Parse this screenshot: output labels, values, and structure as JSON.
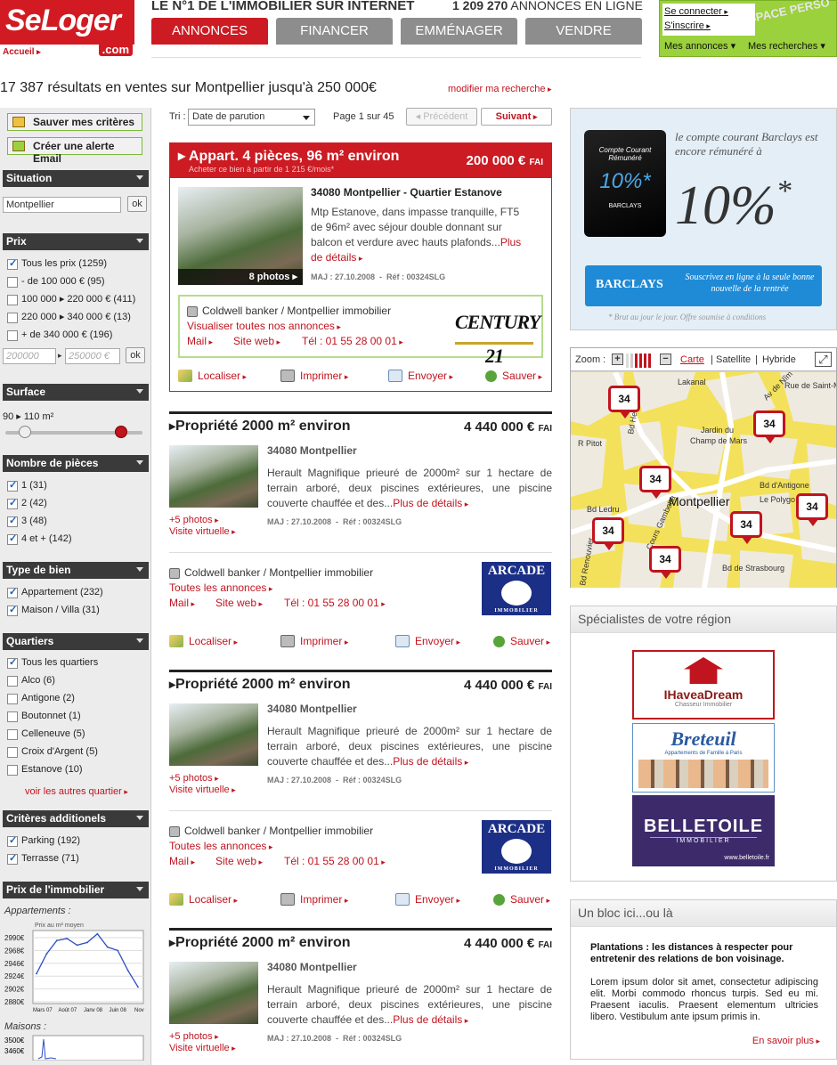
{
  "header": {
    "logo_text": "SeLoger",
    "logo_com": ".com",
    "accueil": "Accueil",
    "tagline": "LE N°1 DE L'IMMOBILIER SUR INTERNET",
    "ad_count": "1 209 270",
    "ad_count_label": "ANNONCES EN LIGNE",
    "tabs": [
      "ANNONCES",
      "FINANCER",
      "EMMÉNAGER",
      "VENDRE"
    ],
    "user": {
      "connect": "Se connecter",
      "signup": "S'inscrire",
      "my_ads": "Mes annonces",
      "my_searches": "Mes recherches",
      "watermark": "ESPACE PERSO"
    }
  },
  "results": {
    "title": "17 387 résultats en ventes sur Montpellier jusqu'à 250 000€",
    "modify": "modifier ma recherche"
  },
  "left": {
    "save_criteria": "Sauver mes critères",
    "create_alert": "Créer une alerte Email",
    "situation": {
      "title": "Situation",
      "value": "Montpellier",
      "ok": "ok"
    },
    "prix": {
      "title": "Prix",
      "options": [
        {
          "label": "Tous les prix (1259)",
          "checked": true
        },
        {
          "label": "- de 100 000 € (95)",
          "checked": false
        },
        {
          "label": "100 000 ▸ 220 000 € (411)",
          "checked": false
        },
        {
          "label": "220 000 ▸ 340 000 € (13)",
          "checked": false
        },
        {
          "label": "+ de 340 000 € (196)",
          "checked": false
        }
      ],
      "min_ph": "200000",
      "max_ph": "250000 €",
      "ok": "ok"
    },
    "surface": {
      "title": "Surface",
      "range": "90 ▸ 110 m²",
      "min_value": 90,
      "max_value": 110
    },
    "pieces": {
      "title": "Nombre de pièces",
      "options": [
        {
          "label": "1 (31)",
          "checked": true
        },
        {
          "label": "2 (42)",
          "checked": true
        },
        {
          "label": "3 (48)",
          "checked": true
        },
        {
          "label": "4 et + (142)",
          "checked": true
        }
      ]
    },
    "type": {
      "title": "Type de bien",
      "options": [
        {
          "label": "Appartement (232)",
          "checked": true
        },
        {
          "label": "Maison / Villa (31)",
          "checked": true
        }
      ]
    },
    "quartiers": {
      "title": "Quartiers",
      "options": [
        {
          "label": "Tous les quartiers",
          "checked": true
        },
        {
          "label": "Alco (6)",
          "checked": false
        },
        {
          "label": "Antigone (2)",
          "checked": false
        },
        {
          "label": "Boutonnet (1)",
          "checked": false
        },
        {
          "label": "Celleneuve (5)",
          "checked": false
        },
        {
          "label": "Croix d'Argent (5)",
          "checked": false
        },
        {
          "label": "Estanove (10)",
          "checked": false
        }
      ],
      "more": "voir les autres quartier"
    },
    "additionnels": {
      "title": "Critères additionels",
      "options": [
        {
          "label": "Parking (192)",
          "checked": true
        },
        {
          "label": "Terrasse (71)",
          "checked": true
        }
      ]
    },
    "prix_immo": {
      "title": "Prix de l'immobilier",
      "apparts": "Appartements :",
      "maisons": "Maisons :",
      "chart_title": "Prix au m² moyen",
      "yticks": [
        "2990€",
        "2968€",
        "2946€",
        "2924€",
        "2902€",
        "2880€"
      ],
      "xticks": [
        "Mars 07",
        "Août 07",
        "Janv 08",
        "Juin 08",
        "Nov"
      ],
      "maison_yticks": [
        "3500€",
        "3460€"
      ]
    }
  },
  "chart_data": {
    "type": "line",
    "title": "Prix au m² moyen",
    "x": [
      "Mars 07",
      "Août 07",
      "Janv 08",
      "Juin 08",
      "Nov"
    ],
    "series": [
      {
        "values": [
          2925,
          2955,
          2975,
          2978,
          2968,
          2972,
          2985,
          2965,
          2960,
          2930,
          2905
        ]
      }
    ],
    "ylim": [
      2880,
      2990
    ]
  },
  "toolbar": {
    "tri_label": "Tri :",
    "tri_value": "Date de parution",
    "page": "Page 1 sur 45",
    "prev": "◂ Précédent",
    "next": "Suivant"
  },
  "featured": {
    "title": "Appart. 4 pièces, 96 m² environ",
    "subtitle": "Acheter ce bien à partir de 1 215 €/mois*",
    "price": "200 000 €",
    "price_unit": "FAI",
    "location": "34080 Montpellier - Quartier Estanove",
    "description": "Mtp Estanove, dans impasse tranquille, FT5 de 96m² avec séjour double donnant sur balcon et verdure avec hauts plafonds...",
    "more": "Plus de détails",
    "photos": "8 photos",
    "maj": "MAJ : 27.10.2008",
    "ref": "Réf : 00324SLG",
    "agency": {
      "name": "Coldwell banker / Montpellier immobilier",
      "all": "Visualiser toutes nos annonces",
      "mail": "Mail",
      "site": "Site web",
      "tel": "Tél : 01 55 28 00 01",
      "logo": "CENTURY 21"
    }
  },
  "actions": {
    "localiser": "Localiser",
    "imprimer": "Imprimer",
    "envoyer": "Envoyer",
    "sauver": "Sauver"
  },
  "listings": [
    {
      "title": "Propriété 2000 m² environ",
      "price": "4 440 000 €",
      "unit": "FAI",
      "location": "34080 Montpellier",
      "description": "Herault Magnifique prieuré de 2000m² sur 1 hectare de terrain arboré, deux piscines extérieures, une piscine couverte chauffée et des...",
      "more": "Plus de détails",
      "photos": "+5 photos",
      "visit": "Visite virtuelle",
      "maj": "MAJ : 27.10.2008",
      "ref": "Réf : 00324SLG",
      "agency": "Coldwell banker / Montpellier immobilier",
      "all": "Toutes les annonces",
      "mail": "Mail",
      "site": "Site web",
      "tel": "Tél : 01 55 28 00 01",
      "logo": "ARCADE",
      "logo_sub": "IMMOBILIER"
    },
    {
      "title": "Propriété 2000 m² environ",
      "price": "4 440 000 €",
      "unit": "FAI",
      "location": "34080 Montpellier",
      "description": "Herault Magnifique prieuré de 2000m² sur 1 hectare de terrain arboré, deux piscines extérieures, une piscine couverte chauffée et des...",
      "more": "Plus de détails",
      "photos": "+5 photos",
      "visit": "Visite virtuelle",
      "maj": "MAJ : 27.10.2008",
      "ref": "Réf : 00324SLG",
      "agency": "Coldwell banker / Montpellier immobilier",
      "all": "Toutes les annonces",
      "mail": "Mail",
      "site": "Site web",
      "tel": "Tél : 01 55 28 00 01",
      "logo": "ARCADE",
      "logo_sub": "IMMOBILIER"
    },
    {
      "title": "Propriété 2000 m² environ",
      "price": "4 440 000 €",
      "unit": "FAI",
      "location": "34080 Montpellier",
      "description": "Herault Magnifique prieuré de 2000m² sur 1 hectare de terrain arboré, deux piscines extérieures, une piscine couverte chauffée et des...",
      "more": "Plus de détails",
      "photos": "+5 photos",
      "visit": "Visite virtuelle",
      "maj": "MAJ : 27.10.2008",
      "ref": "Réf : 00324SLG"
    }
  ],
  "barclays": {
    "card_line1": "Compte Courant",
    "card_line2": "Rémunéré",
    "card_rate": "10%*",
    "card_brand": "BARCLAYS",
    "headline": "le compte courant Barclays est encore rémunéré à",
    "rate": "10%",
    "star": "*",
    "brand": "BARCLAYS",
    "cta": "Souscrivez en ligne à la seule bonne nouvelle de la rentrée",
    "note": "* Brut au jour le jour. Offre soumise à conditions"
  },
  "map": {
    "zoom": "Zoom :",
    "carte": "Carte",
    "satellite": "Satellite",
    "hybride": "Hybride",
    "city": "Montpellier",
    "pin": "34",
    "streets": [
      "Lakanal",
      "Av de Nîm",
      "Rue de Saint-Mau",
      "R Pitot",
      "Bd Henri IV",
      "Jardin du",
      "Champ de Mars",
      "Bd d'Antigone",
      "Le Polygo",
      "Cours Gambetta",
      "Bd Renouvier",
      "Bd de Strasbourg",
      "Bd Ledru"
    ]
  },
  "specialists": {
    "title": "Spécialistes de votre région",
    "items": [
      {
        "name": "IHaveaDream",
        "sub": "Chasseur Immobilier"
      },
      {
        "name": "Breteuil",
        "sub": "Appartements de Famille à Paris"
      },
      {
        "name": "BELLETOILE",
        "sub": "IMMOBILIER",
        "url": "www.belletoile.fr"
      }
    ]
  },
  "bloc": {
    "title": "Un bloc ici...ou là",
    "headline": "Plantations : les distances à respecter pour entretenir des relations de bon voisinage.",
    "text": "Lorem ipsum dolor sit amet, consectetur adipiscing elit. Morbi commodo rhoncus turpis. Sed eu mi. Praesent iaculis. Praesent elementum ultricies libero. Vestibulum ante ipsum primis in.",
    "more": "En savoir plus"
  }
}
